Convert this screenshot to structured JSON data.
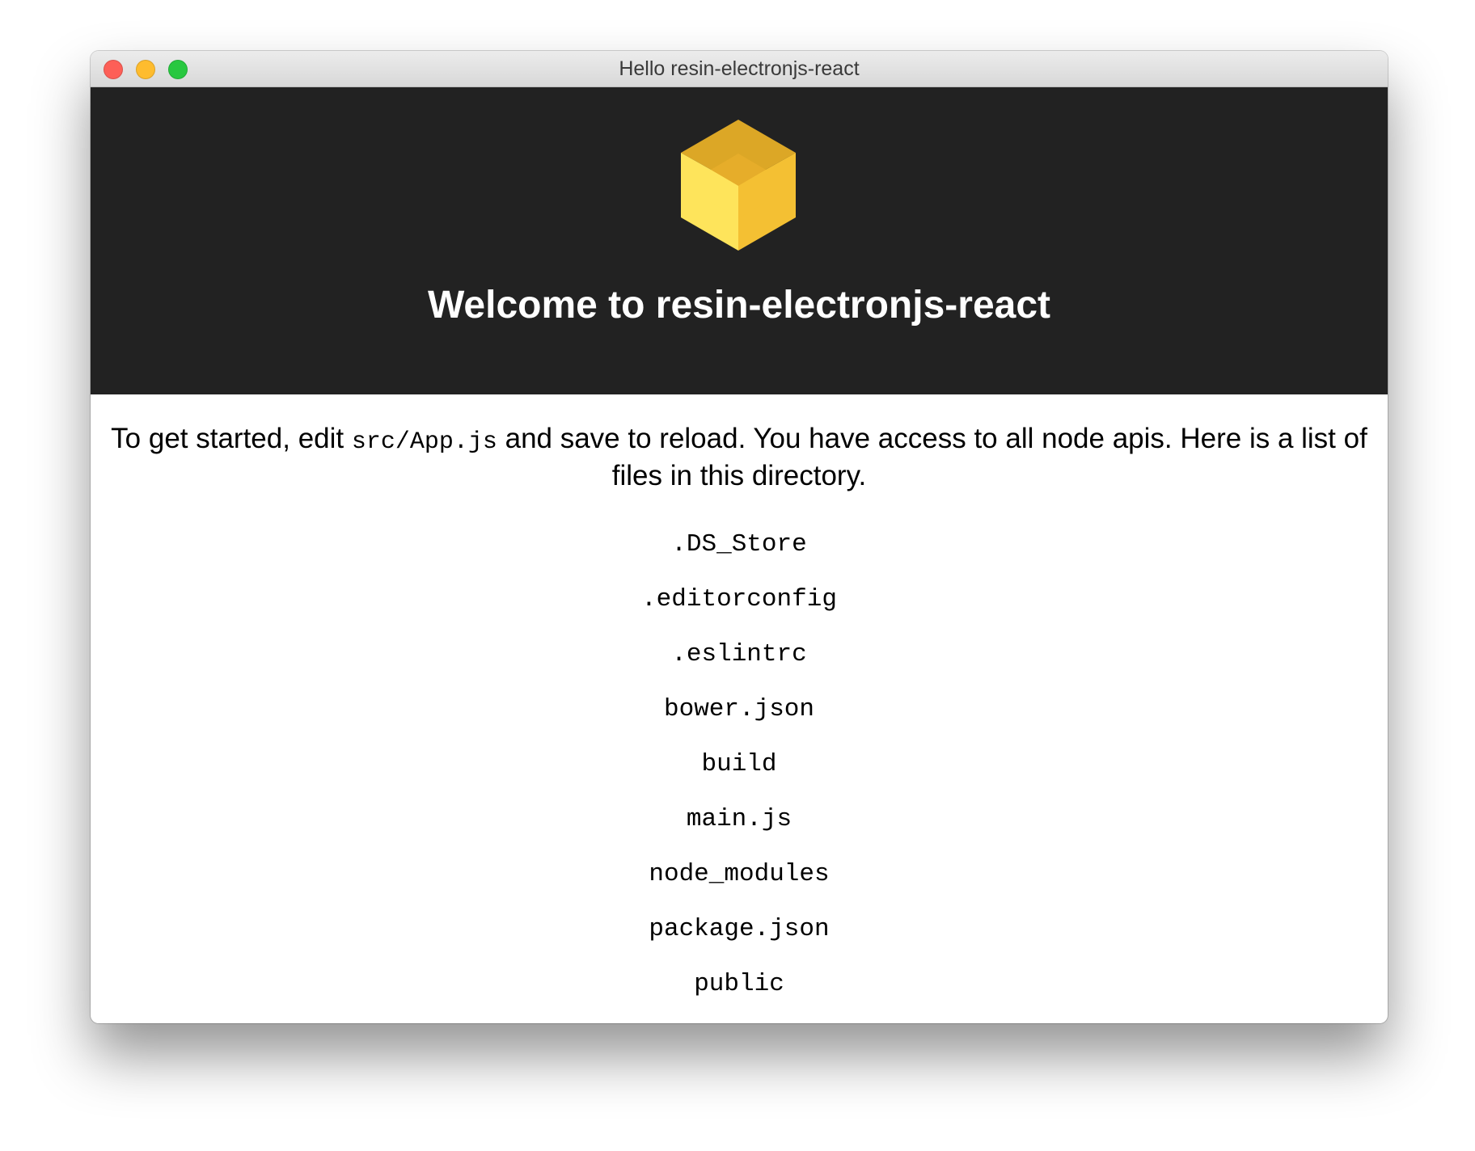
{
  "window": {
    "title": "Hello resin-electronjs-react",
    "controls": [
      {
        "name": "close",
        "color": "#fd5f57"
      },
      {
        "name": "minimize",
        "color": "#febc2e"
      },
      {
        "name": "zoom",
        "color": "#28c840"
      }
    ]
  },
  "header": {
    "title": "Welcome to resin-electronjs-react",
    "background": "#222222",
    "logo_icon": "resin-cube-logo-icon",
    "logo_colors": [
      "#dca726",
      "#f4c033",
      "#fee45b",
      "#e6ad2a"
    ]
  },
  "intro": {
    "prefix": "To get started, edit ",
    "code": "src/App.js",
    "suffix": " and save to reload. You have access to all node apis. Here is a list of files in this directory."
  },
  "files": [
    ".DS_Store",
    ".editorconfig",
    ".eslintrc",
    "bower.json",
    "build",
    "main.js",
    "node_modules",
    "package.json",
    "public"
  ]
}
